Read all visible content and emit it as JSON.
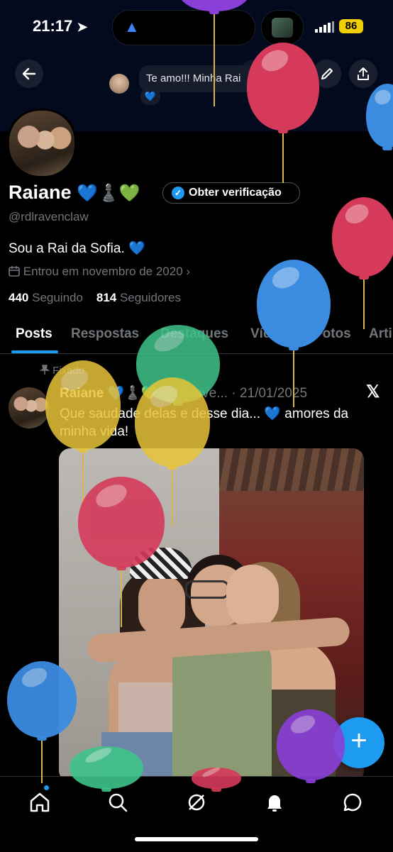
{
  "status_bar": {
    "time": "21:17",
    "battery": "86"
  },
  "notification": {
    "message": "Te amo!!! Minha Rai",
    "reaction": "💙"
  },
  "profile": {
    "name": "Raiane",
    "name_emojis": "💙♟️💚",
    "verify_label": "Obter verificação",
    "handle": "@rdlravenclaw",
    "bio": "Sou a Rai da Sofia. 💙",
    "joined": "Entrou em novembro de 2020",
    "following_count": "440",
    "following_label": "Seguindo",
    "followers_count": "814",
    "followers_label": "Seguidores"
  },
  "tabs": [
    "Posts",
    "Respostas",
    "Destaques",
    "Vídeos",
    "Fotos",
    "Arti"
  ],
  "post": {
    "pinned_label": "Fixado",
    "author": "Raiane 💙♟️💚",
    "handle_date": "@rdlrave... · 21/01/2025",
    "text": "Que saudade delas e desse dia... 💙 amores da minha vida!"
  },
  "colors": {
    "accent": "#1d9bf0",
    "background": "#000000",
    "muted": "#71767b"
  },
  "icons": [
    "back-arrow-icon",
    "grok-icon",
    "search-icon",
    "edit-icon",
    "share-icon",
    "calendar-icon",
    "pin-icon",
    "x-logo-icon",
    "plus-icon",
    "home-icon",
    "explore-icon",
    "grok-nav-icon",
    "bell-icon",
    "messages-icon"
  ]
}
